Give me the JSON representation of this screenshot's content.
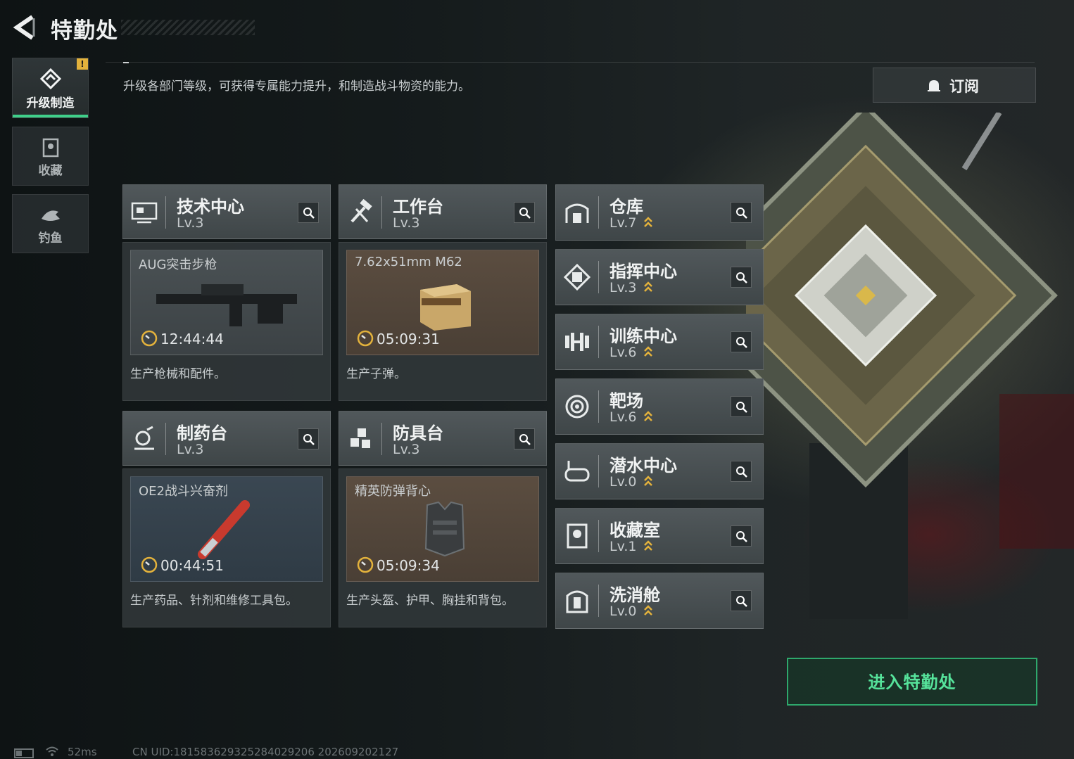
{
  "header": {
    "title": "特勤处"
  },
  "nav": [
    {
      "label": "升级制造",
      "alert": "!"
    },
    {
      "label": "收藏"
    },
    {
      "label": "钓鱼"
    }
  ],
  "description": "升级各部门等级，可获得专属能力提升，和制造战斗物资的能力。",
  "subscribe": {
    "label": "订阅"
  },
  "production": [
    {
      "name": "技术中心",
      "level": "Lv.3",
      "item": "AUG突击步枪",
      "timer": "12:44:44",
      "desc": "生产枪械和配件。",
      "icon": "tech-center-icon"
    },
    {
      "name": "工作台",
      "level": "Lv.3",
      "item": "7.62x51mm M62",
      "timer": "05:09:31",
      "desc": "生产子弹。",
      "icon": "hammer-icon"
    },
    {
      "name": "制药台",
      "level": "Lv.3",
      "item": "OE2战斗兴奋剂",
      "timer": "00:44:51",
      "desc": "生产药品、针剂和维修工具包。",
      "icon": "microscope-icon"
    },
    {
      "name": "防具台",
      "level": "Lv.3",
      "item": "精英防弹背心",
      "timer": "05:09:34",
      "desc": "生产头盔、护甲、胸挂和背包。",
      "icon": "armor-bench-icon"
    }
  ],
  "facilities": [
    {
      "name": "仓库",
      "level": "Lv.7",
      "icon": "warehouse-icon"
    },
    {
      "name": "指挥中心",
      "level": "Lv.3",
      "icon": "command-center-icon"
    },
    {
      "name": "训练中心",
      "level": "Lv.6",
      "icon": "dumbbell-icon"
    },
    {
      "name": "靶场",
      "level": "Lv.6",
      "icon": "target-icon"
    },
    {
      "name": "潜水中心",
      "level": "Lv.0",
      "icon": "diving-mask-icon"
    },
    {
      "name": "收藏室",
      "level": "Lv.1",
      "icon": "collection-room-icon"
    },
    {
      "name": "洗消舱",
      "level": "Lv.0",
      "icon": "decon-chamber-icon"
    }
  ],
  "enter": {
    "label": "进入特勤处"
  },
  "status": {
    "ping": "52ms",
    "uid": "CN UID:1815836293252840292­06 202609202127"
  },
  "colors": {
    "accent": "#3fd08a",
    "upgrade_chevron": "#e3b23c",
    "alert": "#e3b23c"
  }
}
